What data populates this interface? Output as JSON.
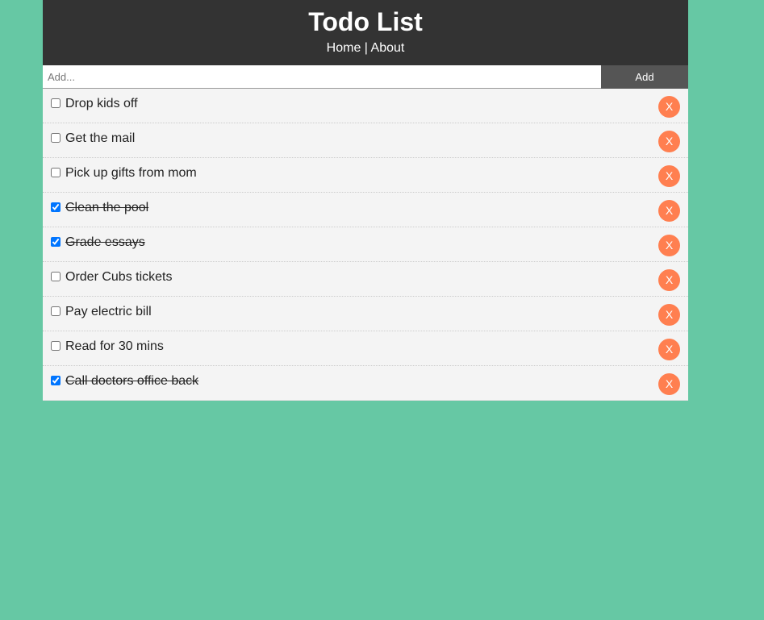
{
  "header": {
    "title": "Todo List",
    "nav": {
      "home_label": "Home",
      "separator": "|",
      "about_label": "About"
    }
  },
  "add_form": {
    "placeholder": "Add...",
    "value": "",
    "submit_label": "Add"
  },
  "todos": [
    {
      "title": "Drop kids off",
      "completed": false,
      "delete_label": "X"
    },
    {
      "title": "Get the mail",
      "completed": false,
      "delete_label": "X"
    },
    {
      "title": "Pick up gifts from mom",
      "completed": false,
      "delete_label": "X"
    },
    {
      "title": "Clean the pool",
      "completed": true,
      "delete_label": "X"
    },
    {
      "title": "Grade essays",
      "completed": true,
      "delete_label": "X"
    },
    {
      "title": "Order Cubs tickets",
      "completed": false,
      "delete_label": "X"
    },
    {
      "title": "Pay electric bill",
      "completed": false,
      "delete_label": "X"
    },
    {
      "title": "Read for 30 mins",
      "completed": false,
      "delete_label": "X"
    },
    {
      "title": "Call doctors office back",
      "completed": true,
      "delete_label": "X"
    }
  ],
  "colors": {
    "page_background": "#66c8a4",
    "header_background": "#333333",
    "add_button_background": "#555555",
    "item_background": "#f4f4f4",
    "delete_button": "#ff7f50"
  }
}
